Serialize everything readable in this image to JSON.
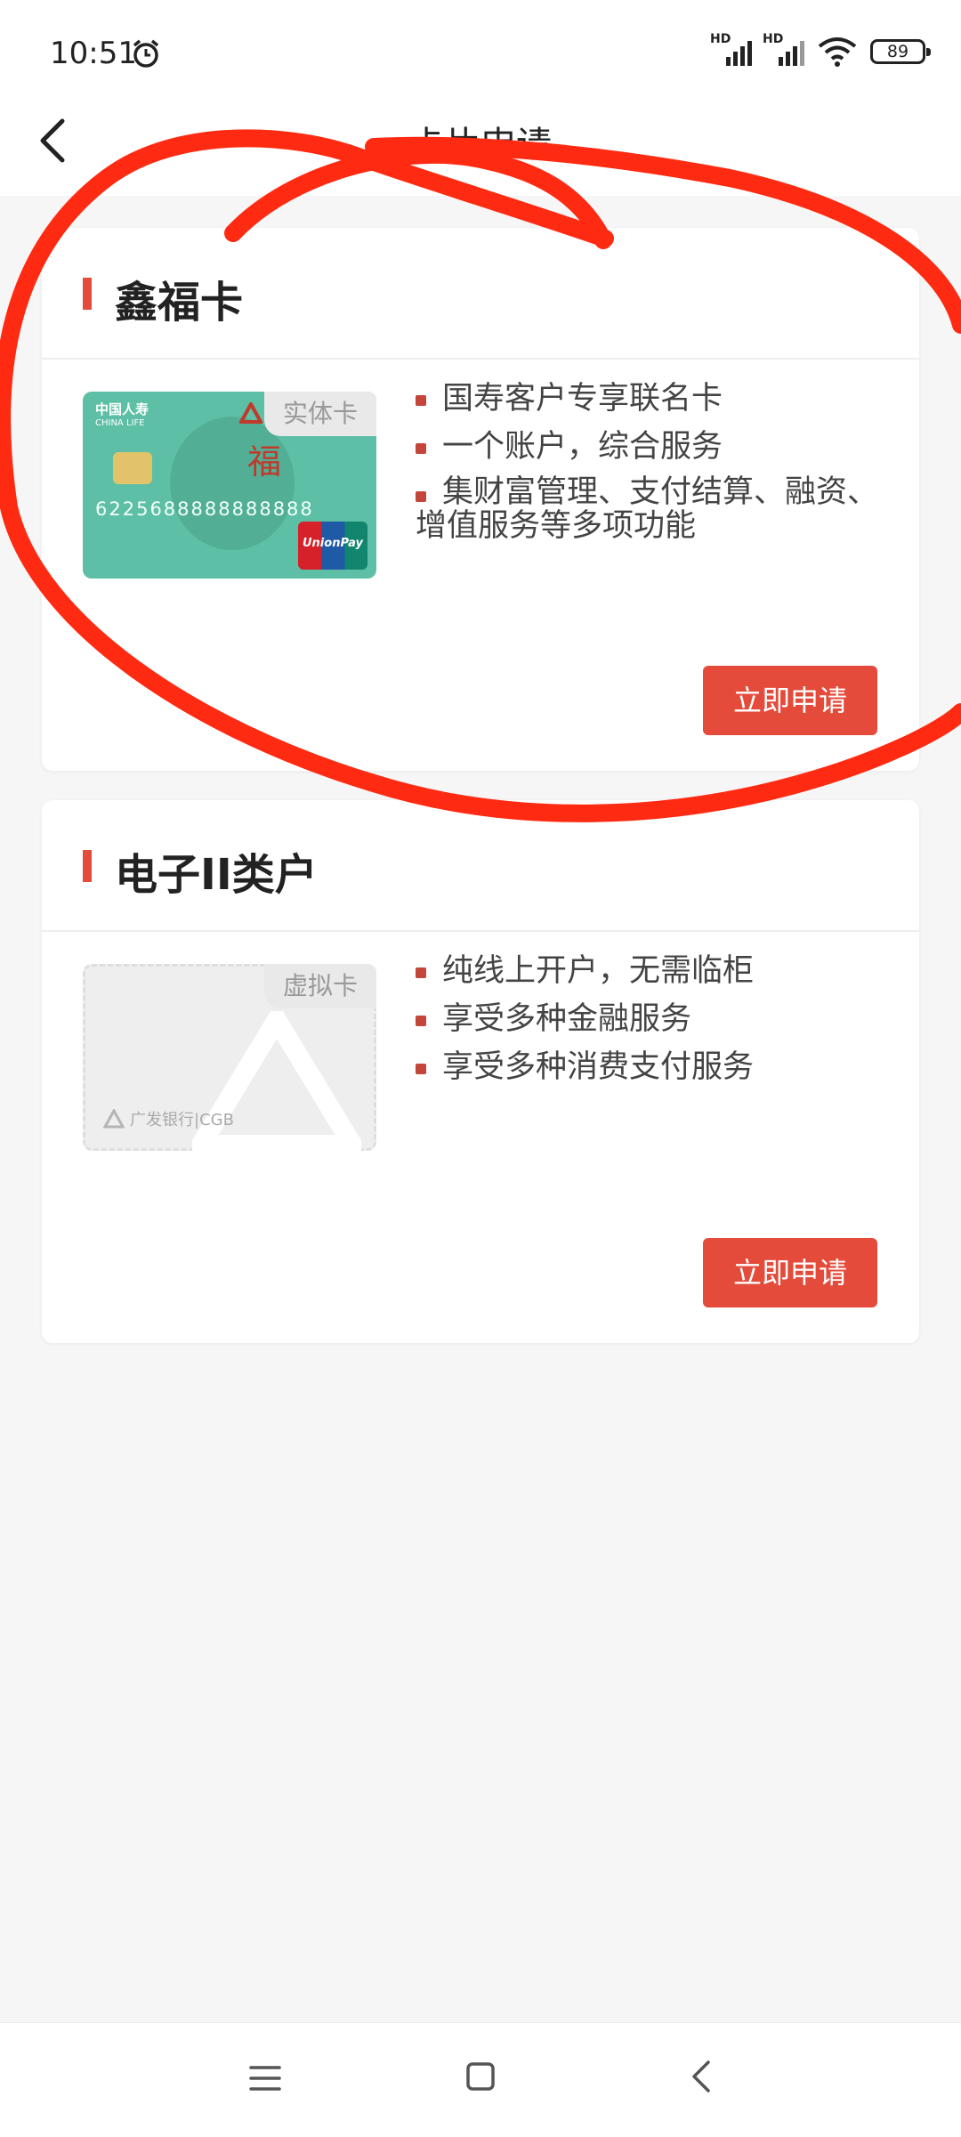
{
  "status_bar": {
    "time": "10:51",
    "signal1_label": "HD",
    "signal2_label": "HD",
    "battery": "89"
  },
  "header": {
    "title": "卡片申请"
  },
  "cards": [
    {
      "title": "鑫福卡",
      "tag": "实体卡",
      "features": [
        "国寿客户专享联名卡",
        "一个账户，综合服务",
        "集财富管理、支付结算、融资、增值服务等多项功能"
      ],
      "apply_label": "立即申请",
      "card_logo": "中国人寿",
      "card_logo_en": "CHINA LIFE",
      "card_number": "6225688888888888",
      "card_char": "福",
      "unionpay_label": "UnionPay"
    },
    {
      "title": "电子II类户",
      "tag": "虚拟卡",
      "features": [
        "纯线上开户，无需临柜",
        "享受多种金融服务",
        "享受多种消费支付服务"
      ],
      "apply_label": "立即申请",
      "bank_logo": "广发银行|CGB"
    }
  ],
  "colors": {
    "accent": "#e44b3b",
    "annotation": "#ff2a12"
  },
  "icons": {
    "back": "chevron-left-icon",
    "alarm": "alarm-clock-icon",
    "wifi": "wifi-icon",
    "nav_menu": "menu-icon",
    "nav_home": "home-square-icon",
    "nav_back": "back-triangle-icon"
  }
}
